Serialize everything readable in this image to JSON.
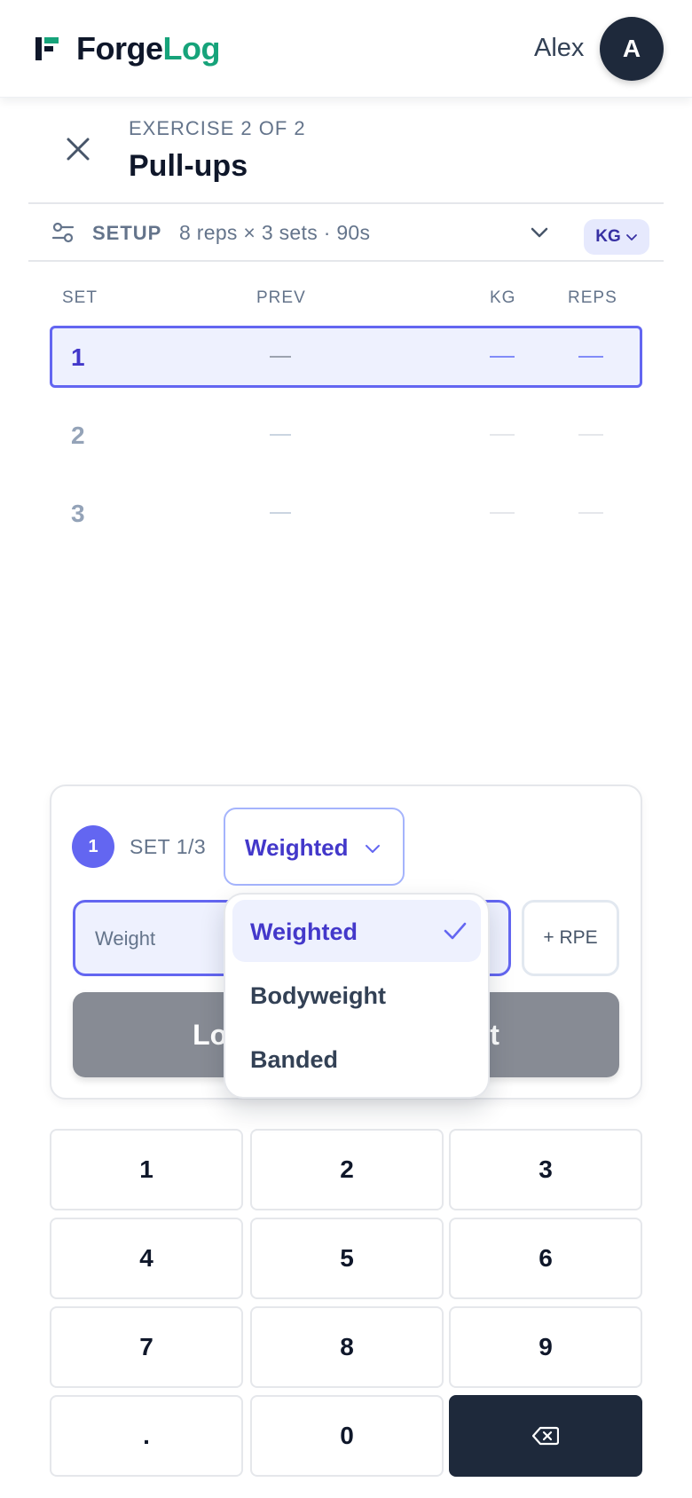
{
  "header": {
    "brand_part1": "Forge",
    "brand_part2": "Log",
    "user_name": "Alex",
    "avatar_initial": "A"
  },
  "exercise": {
    "counter": "EXERCISE 2 OF 2",
    "title": "Pull-ups"
  },
  "setup": {
    "label": "SETUP",
    "summary": "8 reps × 3 sets · 90s",
    "unit": "KG"
  },
  "table": {
    "columns": [
      "SET",
      "PREV",
      "KG",
      "REPS"
    ],
    "rows": [
      {
        "set": "1",
        "active": true
      },
      {
        "set": "2",
        "active": false
      },
      {
        "set": "3",
        "active": false
      }
    ]
  },
  "entry": {
    "set_badge": "1",
    "set_progress": "SET 1/3",
    "mode_value": "Weighted",
    "weight_placeholder": "Weight",
    "rpe_label": "+ RPE",
    "log_button_visible_left": "Lo",
    "log_button_visible_right": "t"
  },
  "mode_menu": {
    "options": [
      "Weighted",
      "Bodyweight",
      "Banded"
    ],
    "selected": "Weighted"
  },
  "keypad": {
    "keys": [
      "1",
      "2",
      "3",
      "4",
      "5",
      "6",
      "7",
      "8",
      "9",
      ".",
      "0"
    ]
  },
  "colors": {
    "accent": "#6366f1",
    "brand_green": "#16a37a",
    "dark": "#1e293b"
  }
}
